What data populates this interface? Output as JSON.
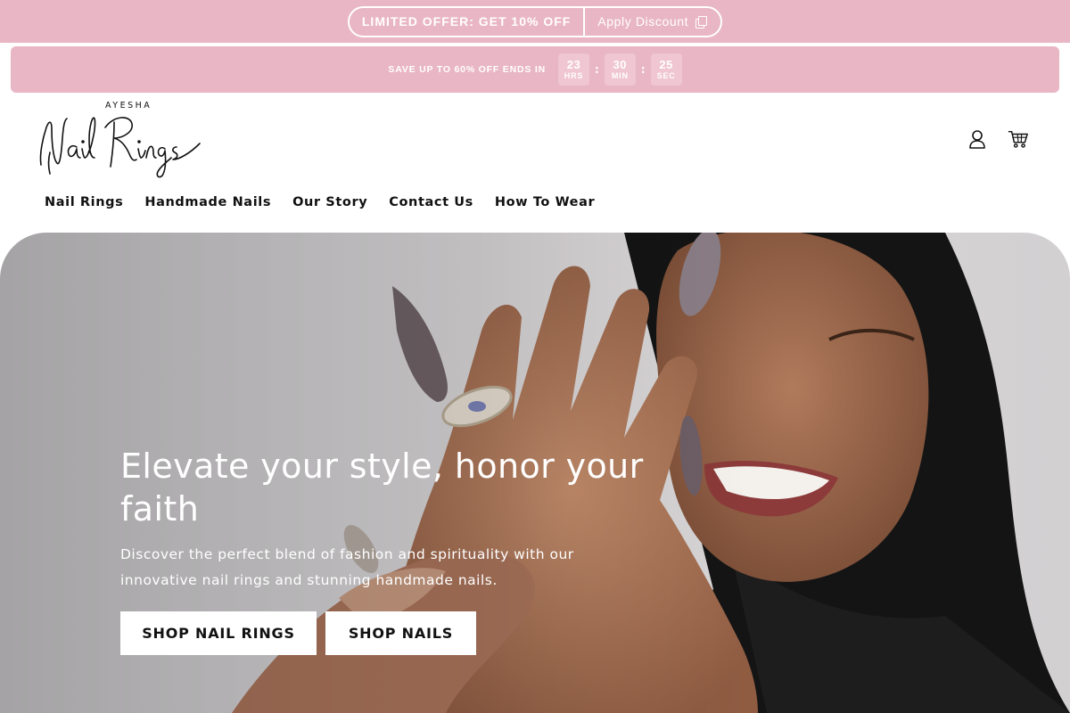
{
  "offer_bar": {
    "text": "LIMITED OFFER: GET 10% OFF",
    "apply_label": "Apply Discount",
    "icon": "copy-icon",
    "bg_color": "#e9b6c5"
  },
  "countdown": {
    "label": "SAVE UP TO 60% OFF ENDS IN",
    "hours": "23",
    "hours_unit": "HRS",
    "minutes": "30",
    "minutes_unit": "MIN",
    "seconds": "25",
    "seconds_unit": "SEC",
    "separator": ":"
  },
  "logo": {
    "top_text": "AYESHA",
    "script_text": "Nail Rings"
  },
  "header_icons": [
    "user-icon",
    "cart-icon"
  ],
  "nav": {
    "items": [
      {
        "label": "Nail Rings"
      },
      {
        "label": "Handmade Nails"
      },
      {
        "label": "Our Story"
      },
      {
        "label": "Contact Us"
      },
      {
        "label": "How To Wear"
      }
    ]
  },
  "hero": {
    "title": "Elevate your style, honor your faith",
    "subtitle": "Discover the perfect blend of fashion and spirituality with our innovative nail rings and stunning handmade nails.",
    "button_primary": "SHOP NAIL RINGS",
    "button_secondary": "SHOP NAILS"
  }
}
